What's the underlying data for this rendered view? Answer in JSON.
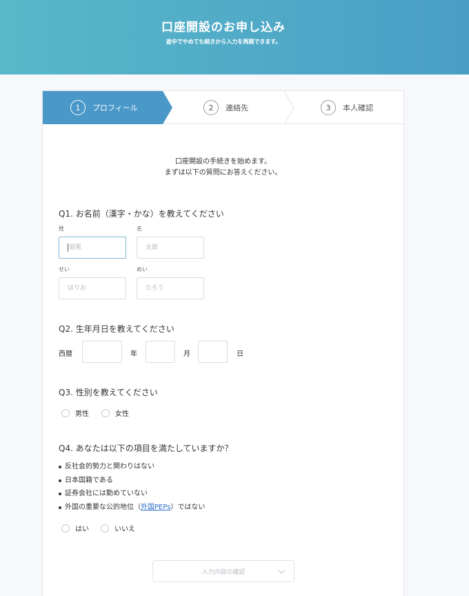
{
  "header": {
    "title": "口座開設のお申し込み",
    "subtitle": "途中でやめても続きから入力を再開できます。"
  },
  "steps": [
    {
      "num": "1",
      "label": "プロフィール"
    },
    {
      "num": "2",
      "label": "連絡先"
    },
    {
      "num": "3",
      "label": "本人確認"
    }
  ],
  "intro": {
    "line1": "口座開設の手続きを始めます。",
    "line2": "まずは以下の質問にお答えください。"
  },
  "q1": {
    "title": "Q1. お名前（漢字・かな）を教えてください",
    "sei_label": "姓",
    "mei_label": "名",
    "sei_placeholder": "堀尾",
    "mei_placeholder": "太郎",
    "sei_kana_label": "せい",
    "mei_kana_label": "めい",
    "sei_kana_placeholder": "ほりお",
    "mei_kana_placeholder": "たろう"
  },
  "q2": {
    "title": "Q2. 生年月日を教えてください",
    "era": "西暦",
    "year": "年",
    "month": "月",
    "day": "日"
  },
  "q3": {
    "title": "Q3. 性別を教えてください",
    "options": [
      "男性",
      "女性"
    ]
  },
  "q4": {
    "title": "Q4. あなたは以下の項目を満たしていますか？",
    "items": [
      "反社会的勢力と関わりはない",
      "日本国籍である",
      "証券会社には勤めていない"
    ],
    "item4_pre": "外国の重要な公的地位（",
    "item4_link": "外国PEPs",
    "item4_post": "）ではない",
    "options": [
      "はい",
      "いいえ"
    ]
  },
  "confirm_label": "入力内容の確認"
}
